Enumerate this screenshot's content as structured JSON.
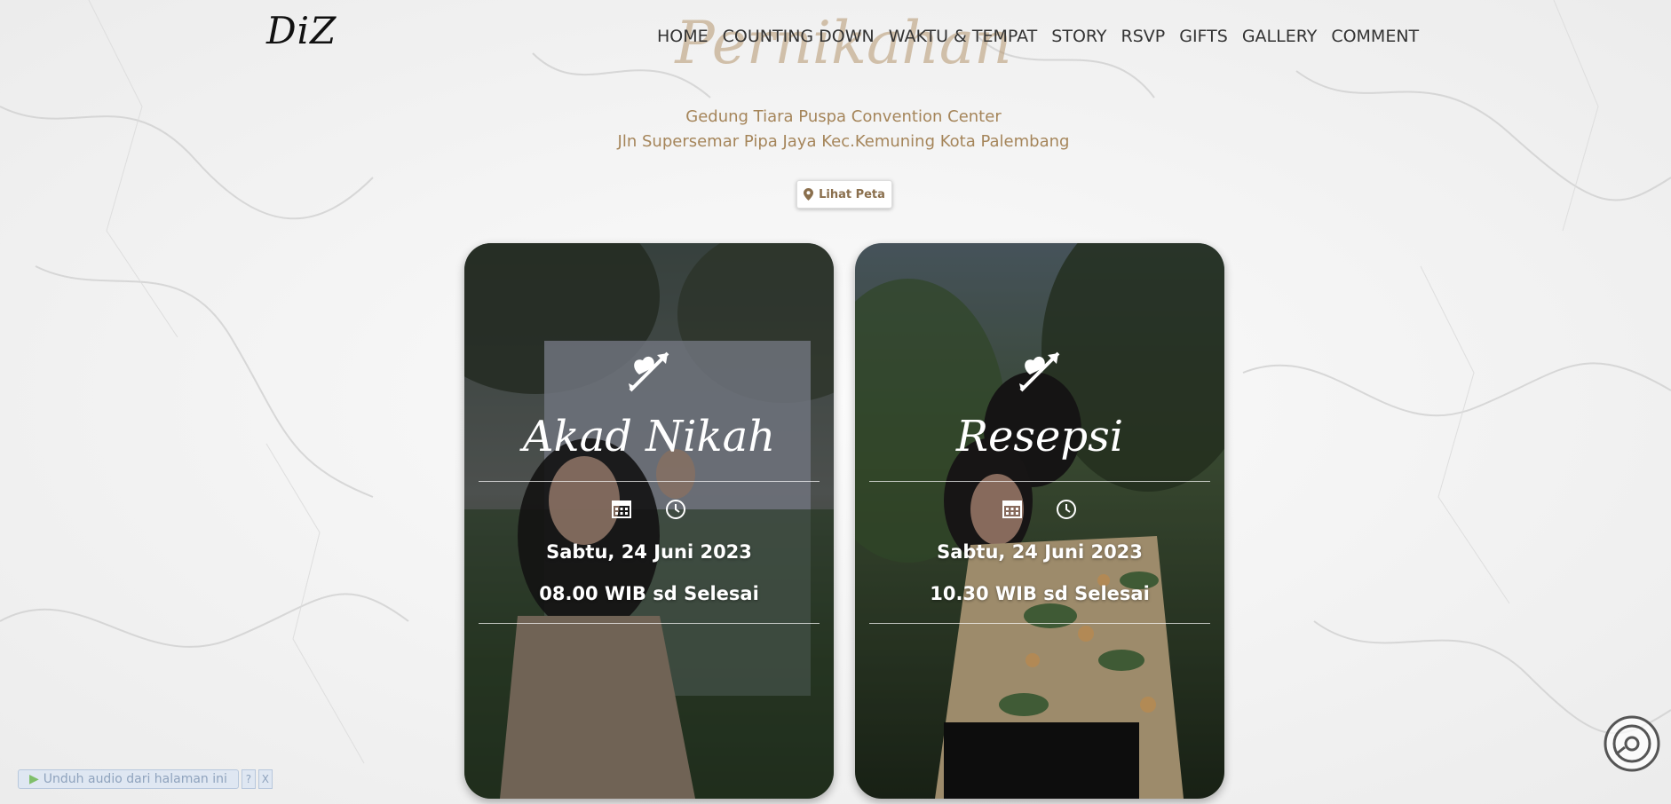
{
  "logo": "DiZ",
  "nav": {
    "items": [
      "HOME",
      "COUNTING DOWN",
      "WAKTU & TEMPAT",
      "STORY",
      "RSVP",
      "GIFTS",
      "GALLERY",
      "COMMENT"
    ]
  },
  "section": {
    "title": "Pernikahan"
  },
  "venue": {
    "name": "Gedung Tiara Puspa Convention Center",
    "address": "Jln Supersemar Pipa Jaya Kec.Kemuning Kota Palembang"
  },
  "map_button": {
    "label": "Lihat Peta",
    "icon": "map-pin-icon"
  },
  "events": [
    {
      "title": "Akad Nikah",
      "date": "Sabtu, 24 Juni 2023",
      "time": "08.00 WIB sd Selesai"
    },
    {
      "title": "Resepsi",
      "date": "Sabtu, 24 Juni 2023",
      "time": "10.30 WIB sd Selesai"
    }
  ],
  "audio_bar": {
    "label": "Unduh audio dari halaman ini",
    "help": "?",
    "close": "X"
  },
  "colors": {
    "accent": "#a5855a",
    "title_faded": "#b4966e"
  }
}
